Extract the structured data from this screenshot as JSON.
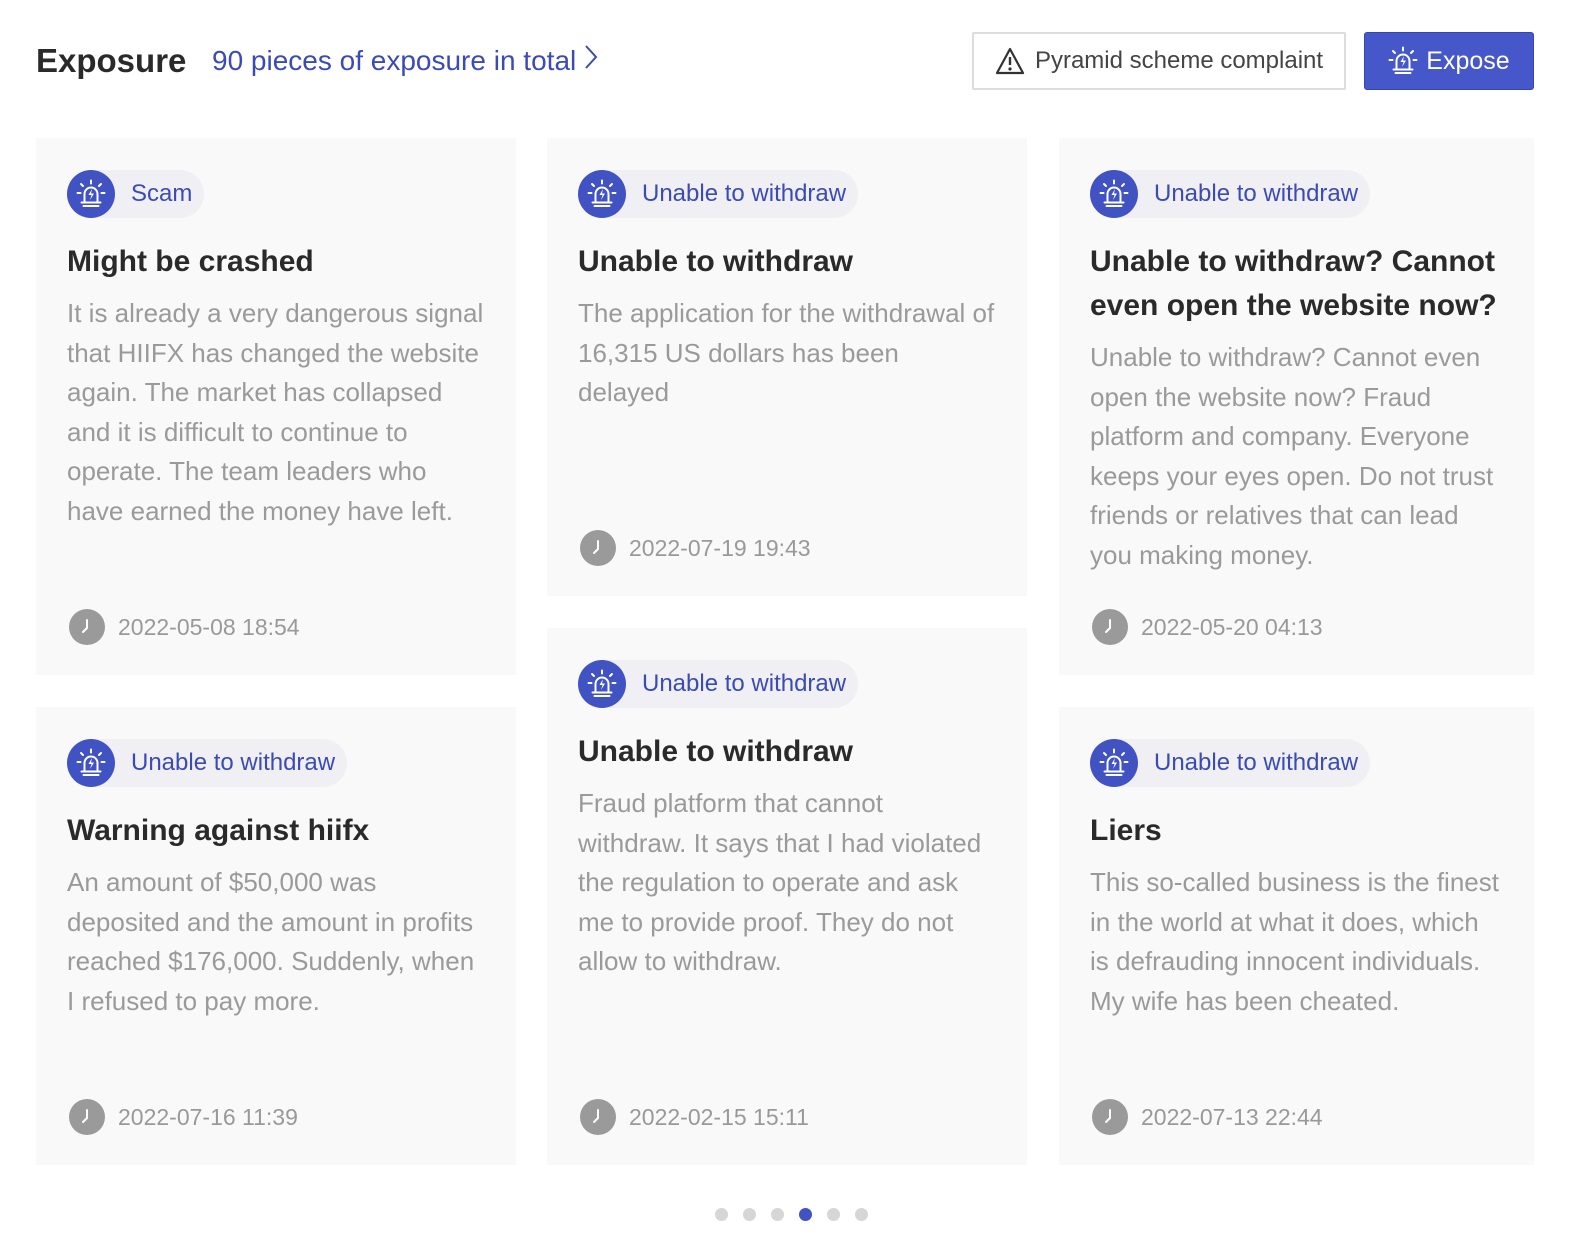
{
  "header": {
    "title": "Exposure",
    "count_link": "90 pieces of exposure in total",
    "complaint_button": "Pyramid scheme complaint",
    "expose_button": "Expose"
  },
  "cards": [
    {
      "tag": "Scam",
      "title": "Might be crashed",
      "body": "It is already a very dangerous signal that HIIFX has changed the website again. The market has collapsed and it is difficult to continue to operate. The team leaders who have earned the money have left.",
      "date": "2022-05-08 18:54"
    },
    {
      "tag": "Unable to withdraw",
      "title": "Unable to withdraw",
      "body": "The application for the withdrawal of 16,315 US dollars has been delayed",
      "date": "2022-07-19 19:43"
    },
    {
      "tag": "Unable to withdraw",
      "title": "Unable to withdraw? Cannot even open the website now?",
      "body": "Unable to withdraw? Cannot even open the website now? Fraud platform and company. Everyone keeps your eyes open. Do not trust friends or relatives that can lead you making money.",
      "date": "2022-05-20 04:13"
    },
    {
      "tag": "Unable to withdraw",
      "title": "Warning against hiifx",
      "body": "An amount of $50,000 was deposited and the amount in profits reached $176,000. Suddenly, when I refused to pay more.",
      "date": "2022-07-16 11:39"
    },
    {
      "tag": "Unable to withdraw",
      "title": "Unable to withdraw",
      "body": "Fraud platform that cannot withdraw. It says that I had violated the regulation to operate and ask me to provide proof. They do not allow to withdraw.",
      "date": "2022-02-15 15:11"
    },
    {
      "tag": "Unable to withdraw",
      "title": "Liers",
      "body": "This so-called business is the finest in the world at what it does, which is defrauding innocent individuals. My wife has been cheated.",
      "date": "2022-07-13 22:44"
    }
  ],
  "pagination": {
    "total": 6,
    "active": 4
  },
  "colors": {
    "accent": "#4152c3",
    "link": "#3b4bb5",
    "card_bg": "#f9f9f9",
    "tag_bg": "#efeff4",
    "muted_text": "#9a9a9a"
  },
  "icons": {
    "count_link": "chevron-right-icon",
    "complaint_button": "warning-triangle-icon",
    "expose_button": "alarm-siren-icon",
    "tag": "alarm-siren-icon",
    "date": "clock-icon"
  }
}
